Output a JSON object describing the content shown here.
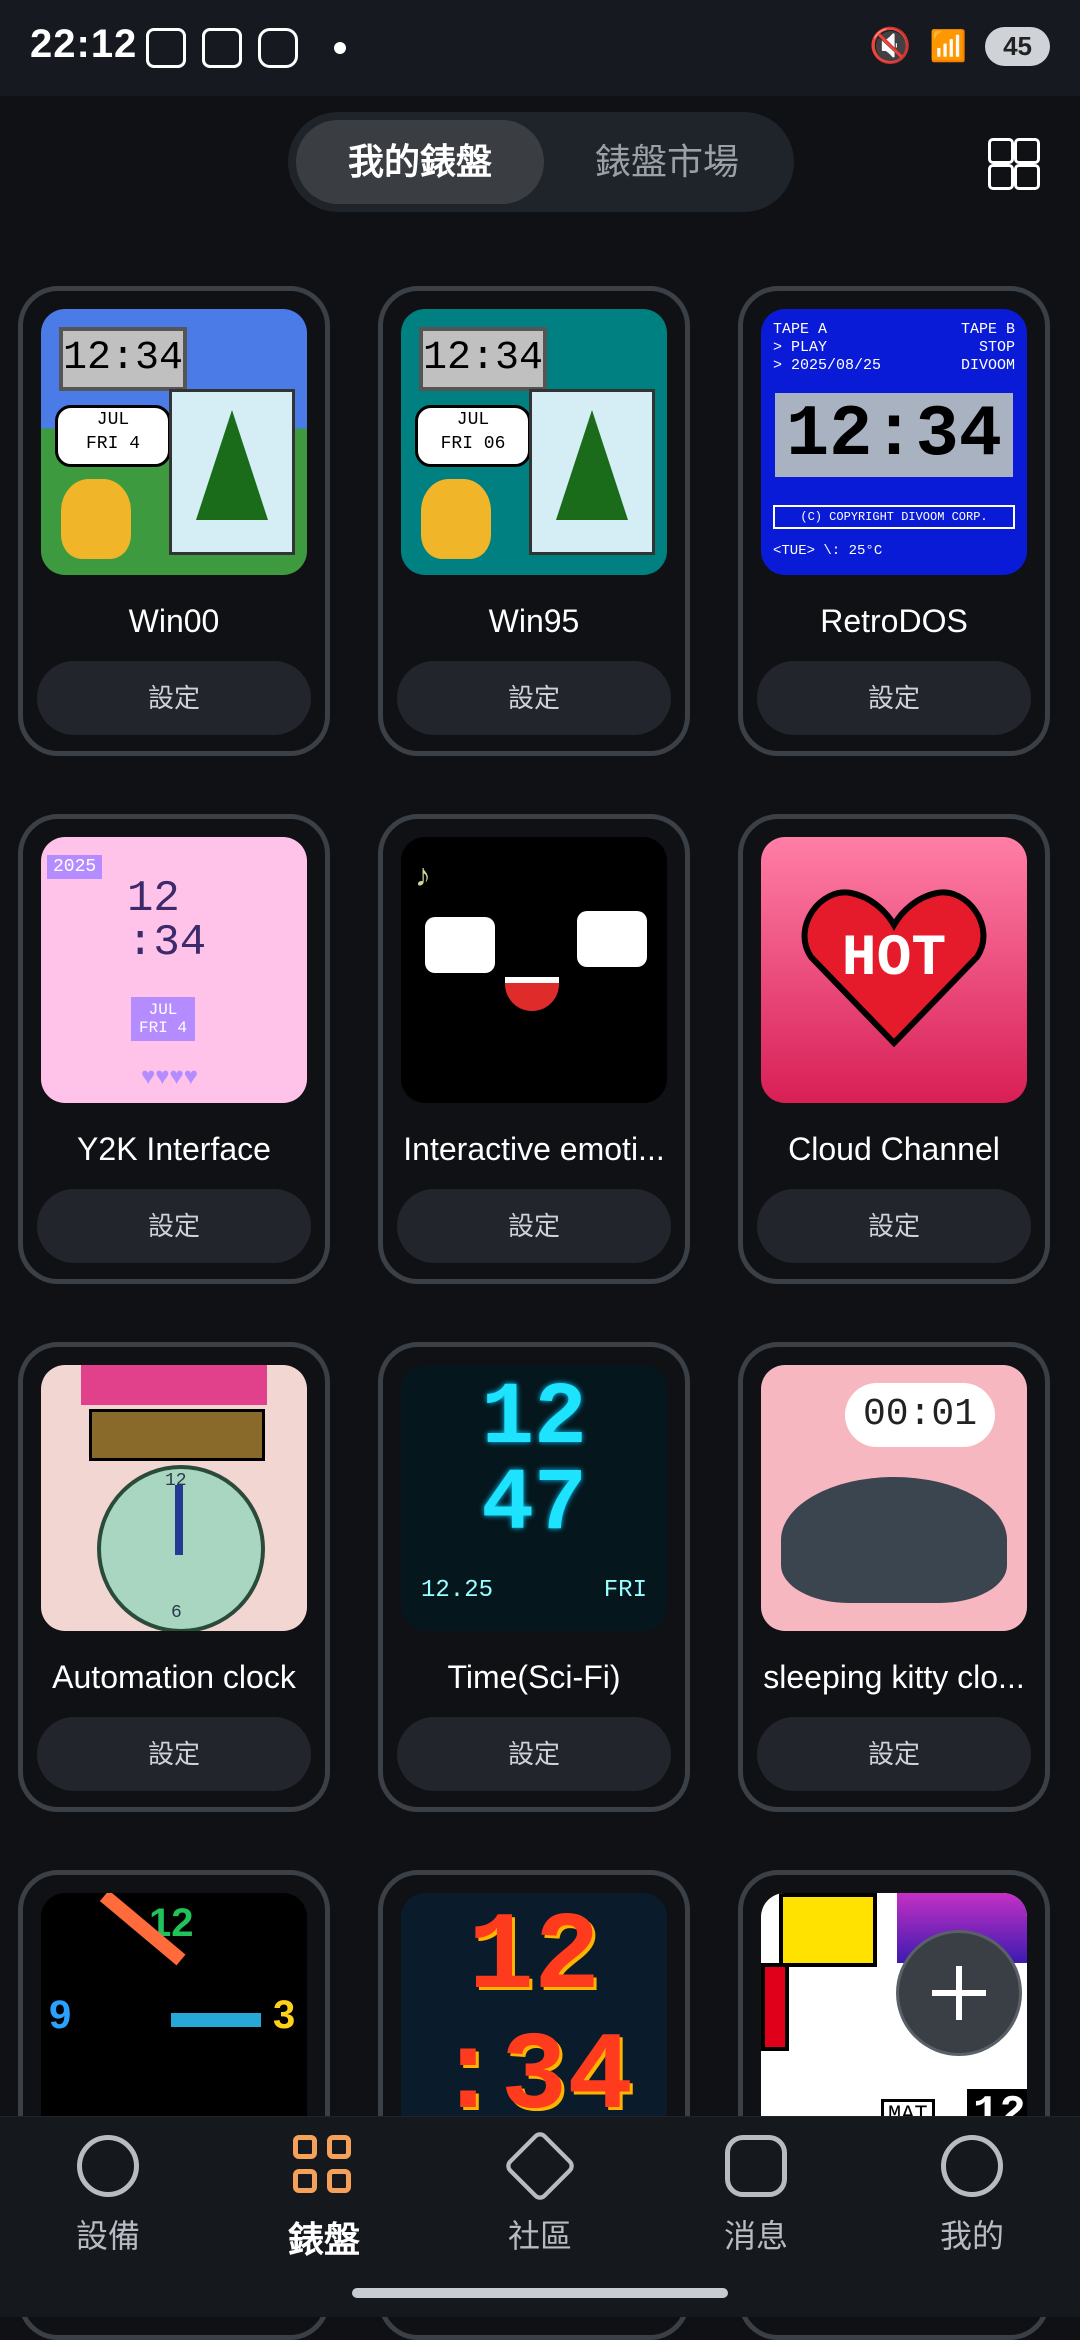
{
  "status_bar": {
    "time": "22:12",
    "battery": "45"
  },
  "header": {
    "tabs": [
      {
        "label": "我的錶盤"
      },
      {
        "label": "錶盤市場"
      }
    ]
  },
  "cards": [
    {
      "name": "Win00",
      "button": "設定",
      "thumb": {
        "time": "12:34",
        "date_line1": "JUL",
        "date_line2": "FRI 4"
      }
    },
    {
      "name": "Win95",
      "button": "設定",
      "thumb": {
        "time": "12:34",
        "date_line1": "JUL",
        "date_line2": "FRI 06"
      }
    },
    {
      "name": "RetroDOS",
      "button": "設定",
      "thumb": {
        "line1_left": "TAPE A",
        "line1_right": "TAPE B",
        "line2_left": "> PLAY",
        "line2_right": "STOP",
        "line3_left": "> 2025/08/25",
        "line3_right": "DIVOOM",
        "time": "12:34",
        "copyright": "(C) COPYRIGHT DIVOOM CORP.",
        "footer": "<TUE> \\: 25°C"
      }
    },
    {
      "name": "Y2K Interface",
      "button": "設定",
      "thumb": {
        "year": "2025",
        "time_hours": "12",
        "time_minutes": ":34",
        "date_line1": "JUL",
        "date_line2": "FRI 4"
      }
    },
    {
      "name": "Interactive emoti...",
      "button": "設定"
    },
    {
      "name": "Cloud Channel",
      "button": "設定",
      "thumb": {
        "text": "HOT"
      }
    },
    {
      "name": "Automation clock",
      "button": "設定",
      "thumb": {
        "n12": "12",
        "n6": "6"
      }
    },
    {
      "name": "Time(Sci-Fi)",
      "button": "設定",
      "thumb": {
        "top": "12",
        "bottom": "47",
        "date": "12.25",
        "day": "FRI"
      }
    },
    {
      "name": "sleeping kitty clo...",
      "button": "設定",
      "thumb": {
        "time": "00:01"
      }
    },
    {
      "name": "",
      "button": "",
      "thumb": {
        "n12": "12",
        "n3": "3",
        "n9": "9"
      }
    },
    {
      "name": "",
      "button": "",
      "thumb": {
        "top": "12",
        "bottom": ":34"
      }
    },
    {
      "name": "",
      "button": "",
      "thumb": {
        "text": "MAT",
        "time": "12"
      }
    }
  ],
  "bottom_nav": [
    {
      "label": "設備",
      "icon": "compass-icon"
    },
    {
      "label": "錶盤",
      "icon": "grid-icon"
    },
    {
      "label": "社區",
      "icon": "cube-icon"
    },
    {
      "label": "消息",
      "icon": "message-icon"
    },
    {
      "label": "我的",
      "icon": "profile-icon"
    }
  ],
  "colors": {
    "accent": "#f5a15a",
    "background": "#0f1115"
  }
}
